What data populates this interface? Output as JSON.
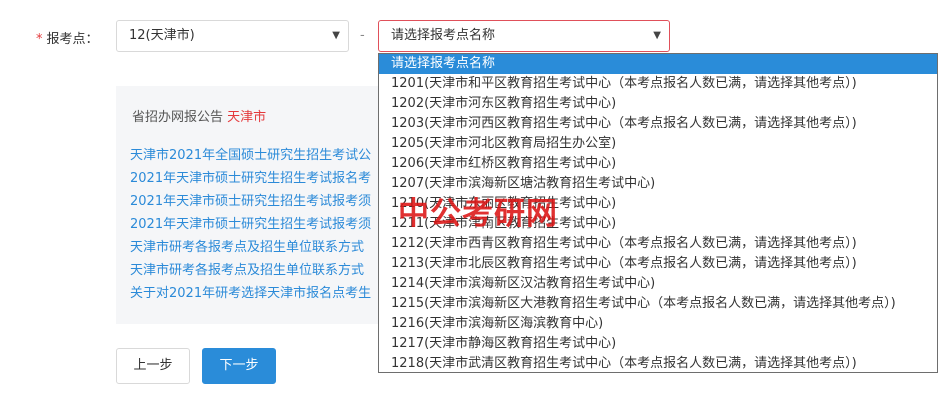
{
  "form": {
    "label": "报考点：",
    "required_mark": "*",
    "city_select": {
      "value": "12(天津市)"
    },
    "separator": "-",
    "point_select": {
      "placeholder": "请选择报考点名称"
    }
  },
  "dropdown": {
    "options": [
      "请选择报考点名称",
      "1201(天津市和平区教育招生考试中心（本考点报名人数已满，请选择其他考点）)",
      "1202(天津市河东区教育招生考试中心)",
      "1203(天津市河西区教育招生考试中心（本考点报名人数已满，请选择其他考点）)",
      "1205(天津市河北区教育局招生办公室)",
      "1206(天津市红桥区教育招生考试中心)",
      "1207(天津市滨海新区塘沽教育招生考试中心)",
      "1210(天津市东丽区教育招生考试中心)",
      "1211(天津市津南区教育招生考试中心)",
      "1212(天津市西青区教育招生考试中心（本考点报名人数已满，请选择其他考点）)",
      "1213(天津市北辰区教育招生考试中心（本考点报名人数已满，请选择其他考点）)",
      "1214(天津市滨海新区汉沽教育招生考试中心)",
      "1215(天津市滨海新区大港教育招生考试中心（本考点报名人数已满，请选择其他考点）)",
      "1216(天津市滨海新区海滨教育中心)",
      "1217(天津市静海区教育招生考试中心)",
      "1218(天津市武清区教育招生考试中心（本考点报名人数已满，请选择其他考点）)"
    ]
  },
  "notice": {
    "title": "省招办网报公告",
    "city": "天津市",
    "links": [
      "天津市2021年全国硕士研究生招生考试公",
      "2021年天津市硕士研究生招生考试报名考",
      "2021年天津市硕士研究生招生考试报考须",
      "2021年天津市硕士研究生招生考试报考须",
      "天津市研考各报考点及招生单位联系方式",
      "天津市研考各报考点及招生单位联系方式",
      "关于对2021年研考选择天津市报名点考生"
    ]
  },
  "buttons": {
    "prev": "上一步",
    "next": "下一步"
  },
  "watermark": "中公考研网",
  "colors": {
    "accent": "#2a8cd9",
    "required": "#e4393c",
    "link": "#2b8ad8"
  }
}
